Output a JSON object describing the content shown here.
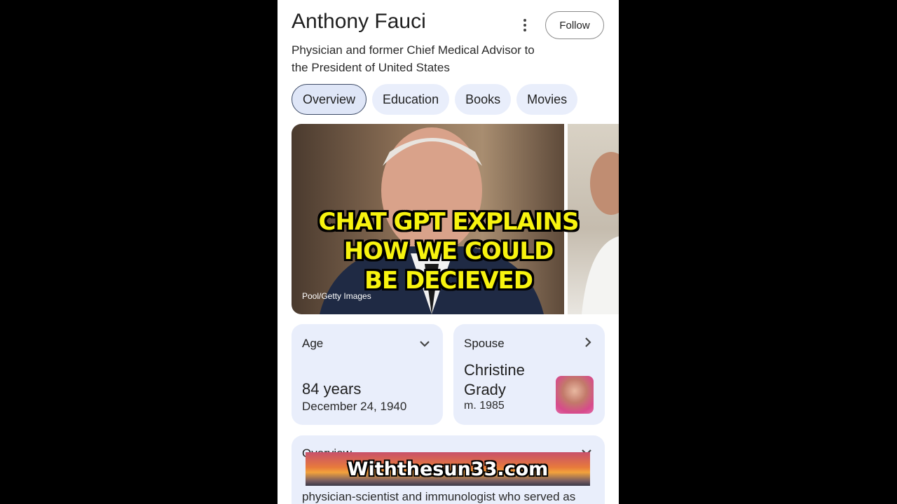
{
  "header": {
    "title": "Anthony Fauci",
    "subtitle": "Physician and former Chief Medical Advisor to the President of United States",
    "follow_label": "Follow"
  },
  "tabs": [
    {
      "label": "Overview",
      "active": true
    },
    {
      "label": "Education",
      "active": false
    },
    {
      "label": "Books",
      "active": false
    },
    {
      "label": "Movies",
      "active": false
    }
  ],
  "media": {
    "credit": "Pool/Getty Images"
  },
  "cards": {
    "age": {
      "label": "Age",
      "value": "84 years",
      "sub": "December 24, 1940"
    },
    "spouse": {
      "label": "Spouse",
      "name": "Christine Grady",
      "sub": "m. 1985"
    }
  },
  "overview": {
    "label": "Overview",
    "text": "physician-scientist and immunologist who served as"
  },
  "overlay": {
    "caption_lines": [
      "CHAT GPT EXPLAINS",
      "HOW WE COULD",
      "BE DECIEVED"
    ],
    "banner": "Withthesun33.com"
  },
  "icons": {
    "more": "more-vert-icon",
    "expand": "chevron-down-icon",
    "next": "chevron-right-icon"
  },
  "colors": {
    "chip_bg": "#e9eefb",
    "caption_yellow": "#f7f30f"
  }
}
